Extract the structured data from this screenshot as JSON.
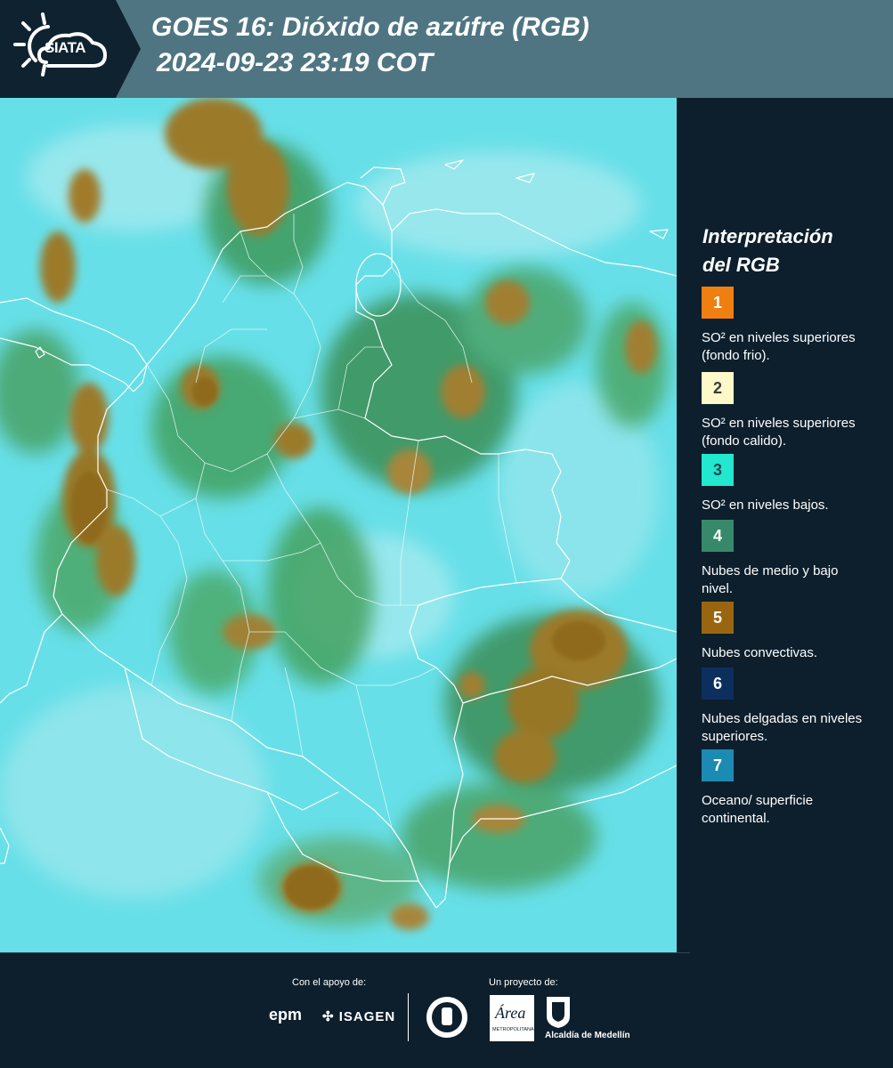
{
  "header": {
    "logo_text": "SIATA",
    "title_line1": "GOES 16: Dióxido de azúfre (RGB)",
    "title_line2": "2024-09-23 23:19 COT"
  },
  "legend": {
    "title_line1": "Interpretación",
    "title_line2": "del RGB",
    "items": [
      {
        "number": "1",
        "color": "#f07f12",
        "text_color": "#ffffff",
        "description": "SO² en niveles superiores (fondo frio)."
      },
      {
        "number": "2",
        "color": "#fff8c8",
        "text_color": "#3b3b3b",
        "description": "SO² en niveles superiores (fondo calido)."
      },
      {
        "number": "3",
        "color": "#21e8cf",
        "text_color": "#1a4b55",
        "description": "SO² en niveles bajos."
      },
      {
        "number": "4",
        "color": "#37896b",
        "text_color": "#ffffff",
        "description": "Nubes de medio y bajo nivel."
      },
      {
        "number": "5",
        "color": "#9a6510",
        "text_color": "#ffffff",
        "description": "Nubes convectivas."
      },
      {
        "number": "6",
        "color": "#0c2f5e",
        "text_color": "#ffffff",
        "description": "Nubes delgadas en niveles superiores."
      },
      {
        "number": "7",
        "color": "#1b8bb3",
        "text_color": "#ffffff",
        "description": "Oceano/ superficie continental."
      }
    ]
  },
  "footer": {
    "support_label": "Con el apoyo de:",
    "project_label": "Un proyecto de:",
    "sponsor1": "epm",
    "sponsor2": "ISAGEN",
    "partner_amva": "Área",
    "partner_amva_sub": "METROPOLITANA",
    "partner_alcaldia": "Alcaldía de Medellín"
  },
  "colors": {
    "ocean": "#67dfe8",
    "low_cloud": "#3f9e58",
    "convective": "#9a7a2a",
    "borders": "#ffffff"
  }
}
